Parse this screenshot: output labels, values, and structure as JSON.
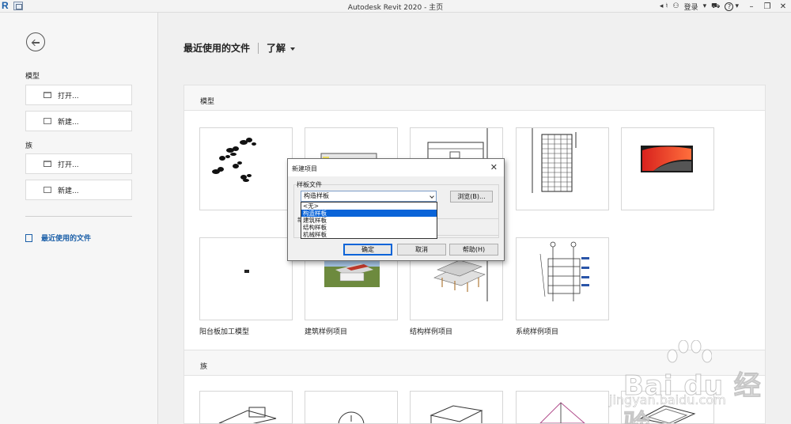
{
  "window": {
    "title": "Autodesk Revit 2020 - 主页",
    "login_label": "登录",
    "help_label": "?"
  },
  "sidebar": {
    "model_heading": "模型",
    "model_open": "打开...",
    "model_new": "新建...",
    "family_heading": "族",
    "family_open": "打开...",
    "family_new": "新建...",
    "recent_files": "最近使用的文件"
  },
  "main": {
    "title": "最近使用的文件",
    "learn": "了解",
    "models_section": "模型",
    "families_section": "族",
    "model_thumbnails": [
      {
        "caption": ""
      },
      {
        "caption": ""
      },
      {
        "caption": ""
      },
      {
        "caption": ""
      },
      {
        "caption": ""
      },
      {
        "caption": "阳台板加工模型"
      },
      {
        "caption": "建筑样例项目"
      },
      {
        "caption": "结构样例项目"
      },
      {
        "caption": "系统样例项目"
      }
    ]
  },
  "dialog": {
    "title": "新建项目",
    "group_label": "样板文件",
    "selected_value": "构造样板",
    "browse_button": "浏览(B)...",
    "options": [
      "<无>",
      "构造样板",
      "建筑样板",
      "结构样板",
      "机械样板"
    ],
    "selected_index": 1,
    "hidden_label": "新",
    "ok_button": "确定",
    "cancel_button": "取消",
    "help_button": "帮助(H)"
  },
  "watermark": {
    "brand": "Bai du 经验",
    "url": "jingyan.baidu.com"
  },
  "colors": {
    "accent": "#1b5fa8",
    "selection": "#0a64d8"
  }
}
